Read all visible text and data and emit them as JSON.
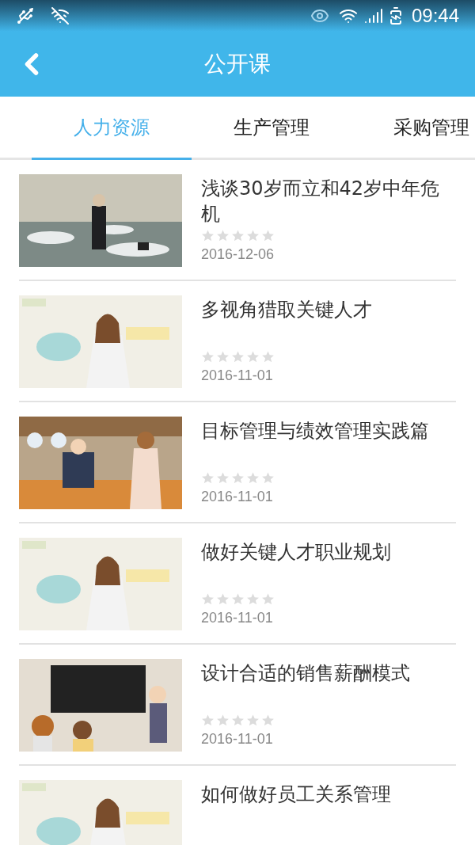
{
  "status_bar": {
    "time": "09:44"
  },
  "header": {
    "title": "公开课"
  },
  "tabs": [
    {
      "label": "人力资源",
      "selected": true
    },
    {
      "label": "生产管理",
      "selected": false
    },
    {
      "label": "采购管理",
      "selected": false
    }
  ],
  "courses": [
    {
      "title": "浅谈30岁而立和42岁中年危机",
      "stars": 0,
      "date": "2016-12-06"
    },
    {
      "title": "多视角猎取关键人才",
      "stars": 0,
      "date": "2016-11-01"
    },
    {
      "title": "目标管理与绩效管理实践篇",
      "stars": 0,
      "date": "2016-11-01"
    },
    {
      "title": "做好关键人才职业规划",
      "stars": 0,
      "date": "2016-11-01"
    },
    {
      "title": "设计合适的销售薪酬模式",
      "stars": 0,
      "date": "2016-11-01"
    },
    {
      "title": "如何做好员工关系管理"
    }
  ]
}
